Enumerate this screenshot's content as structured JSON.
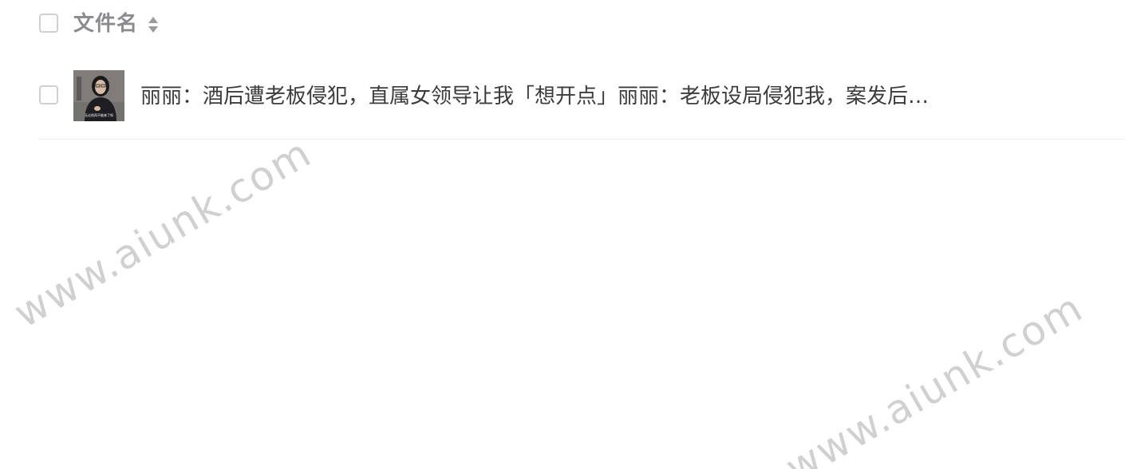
{
  "header": {
    "column_label": "文件名",
    "sort_icon": "sort-icon"
  },
  "rows": [
    {
      "name": "丽丽：酒后遭老板侵犯，直属女领导让我「想开点」丽丽：老板设局侵犯我，案发后…",
      "thumbnail_caption": "无论他再不能来了呀"
    }
  ],
  "watermarks": [
    "www.aiunk.com",
    "www.aiunk.com"
  ],
  "colors": {
    "border": "#cfcfd4",
    "header_text": "#8a8a8f",
    "body_text": "#3c3c3c",
    "divider": "#ececef"
  }
}
